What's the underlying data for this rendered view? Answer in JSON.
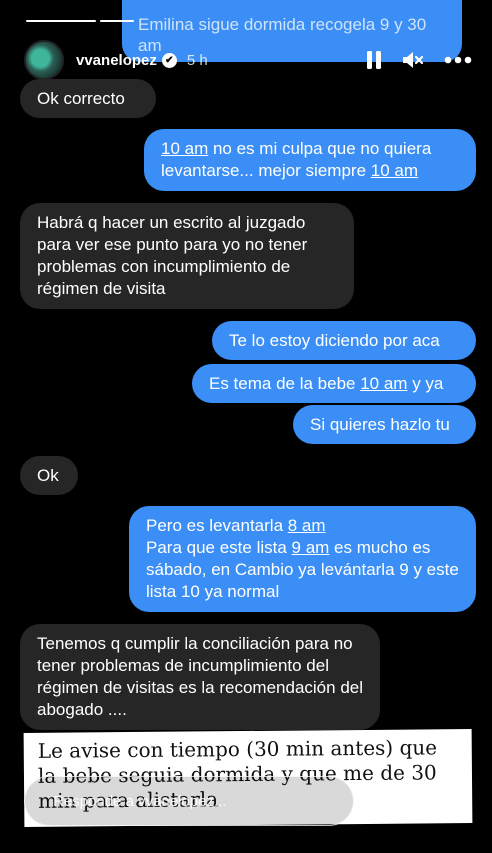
{
  "header": {
    "username": "vvanelopez",
    "time_ago": "5 h",
    "verified_mark": "✔"
  },
  "top_bubble": {
    "text": "Emilina sigue dormida recogela 9 y 30 am"
  },
  "messages": [
    {
      "side": "left",
      "parts": [
        {
          "t": "Ok correcto"
        }
      ]
    },
    {
      "side": "right",
      "parts": [
        {
          "t": "10 am",
          "u": true
        },
        {
          "t": " no es mi culpa que no quiera levantarse... mejor siempre "
        },
        {
          "t": "10 am",
          "u": true
        }
      ]
    },
    {
      "side": "left",
      "parts": [
        {
          "t": "Habrá q hacer un escrito al juzgado para ver ese punto para yo no tener problemas con incumplimiento de régimen de visita"
        }
      ]
    },
    {
      "side": "right",
      "parts": [
        {
          "t": "Te lo estoy diciendo por aca"
        }
      ]
    },
    {
      "side": "right",
      "parts": [
        {
          "t": "Es tema de la bebe "
        },
        {
          "t": "10 am",
          "u": true
        },
        {
          "t": " y ya"
        }
      ]
    },
    {
      "side": "right",
      "parts": [
        {
          "t": "Si quieres hazlo tu"
        }
      ]
    },
    {
      "side": "left",
      "parts": [
        {
          "t": "Ok"
        }
      ]
    },
    {
      "side": "right",
      "parts": [
        {
          "t": "Pero es levantarla "
        },
        {
          "t": "8 am",
          "u": true
        },
        {
          "t": "\nPara que este lista "
        },
        {
          "t": "9 am",
          "u": true
        },
        {
          "t": " es mucho es sábado, en Cambio ya levántarla 9 y este lista 10 ya normal"
        }
      ]
    },
    {
      "side": "left",
      "parts": [
        {
          "t": "Tenemos q cumplir la conciliación para no tener problemas de incumplimiento del régimen de visitas es la recomendación del abogado ...."
        }
      ]
    }
  ],
  "note": {
    "text": "Le avise con tiempo (30 min antes) que la bebe seguia dormida y que me de 30 min para alistarla"
  },
  "reply": {
    "placeholder": "Responde a vvanelopez..."
  },
  "icons": {
    "pause": "pause-icon",
    "mute": "speaker-muted-icon",
    "more": "more-options-icon",
    "like": "heart-icon",
    "send": "send-icon"
  },
  "colors": {
    "incoming_bubble": "#262626",
    "outgoing_bubble": "#3a8ef5",
    "background": "#000000"
  }
}
